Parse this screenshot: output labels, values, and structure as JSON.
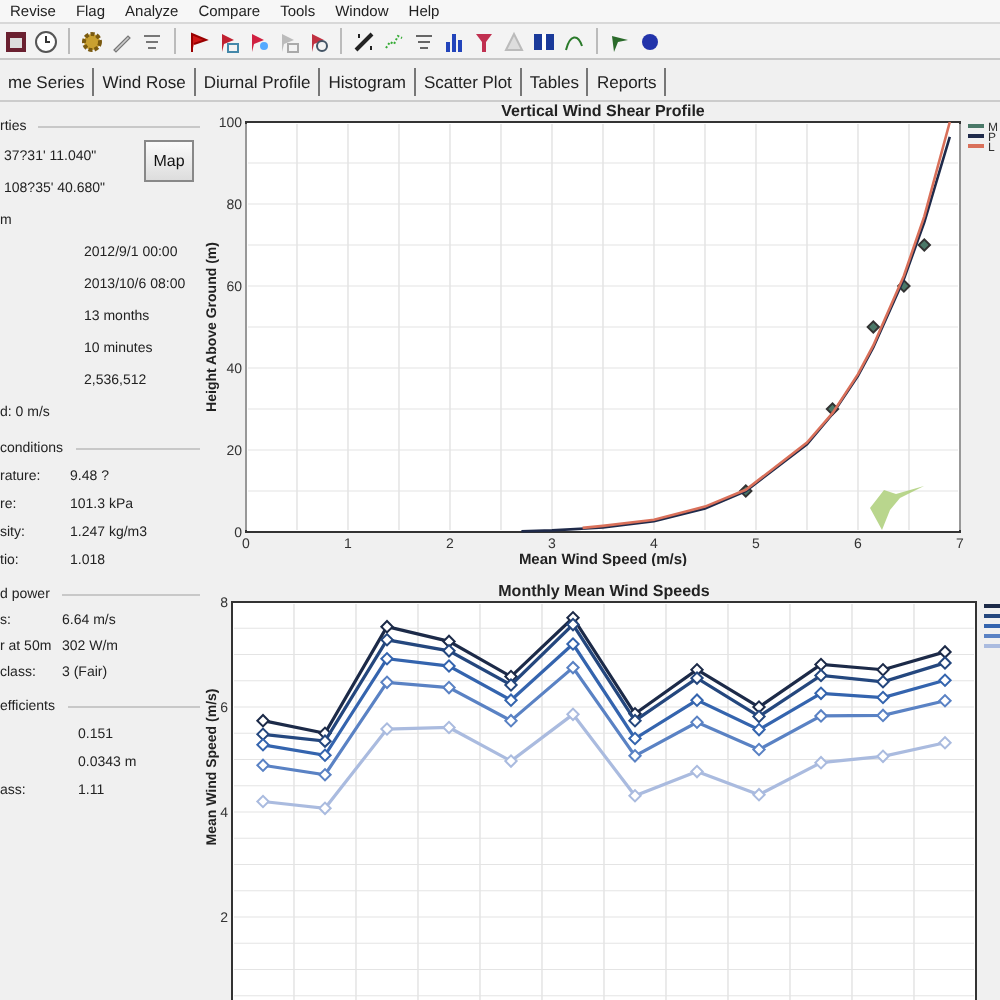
{
  "menu": [
    "Revise",
    "Flag",
    "Analyze",
    "Compare",
    "Tools",
    "Window",
    "Help"
  ],
  "tabs": [
    {
      "label": "me Series",
      "selected": false
    },
    {
      "label": "Wind Rose",
      "selected": false
    },
    {
      "label": "Diurnal Profile",
      "selected": false
    },
    {
      "label": "Histogram",
      "selected": false
    },
    {
      "label": "Scatter Plot",
      "selected": false
    },
    {
      "label": "Tables",
      "selected": false
    },
    {
      "label": "Reports",
      "selected": false
    }
  ],
  "properties": {
    "map_button": "Map",
    "groups": [
      {
        "title": "rties",
        "rows": [
          {
            "value": "37?31' 11.040\""
          },
          {
            "value": "108?35' 40.680\""
          },
          {
            "label": "m"
          },
          {
            "value": "2012/9/1 00:00"
          },
          {
            "value": "2013/10/6 08:00"
          },
          {
            "value": "13 months"
          },
          {
            "value": "10 minutes"
          },
          {
            "value": "2,536,512"
          },
          {
            "label": "d: 0 m/s"
          }
        ]
      },
      {
        "title": "conditions",
        "rows": [
          {
            "label": "rature:",
            "value": "9.48 ?"
          },
          {
            "label": "re:",
            "value": "101.3 kPa"
          },
          {
            "label": "sity:",
            "value": "1.247 kg/m3"
          },
          {
            "label": "tio:",
            "value": "1.018"
          }
        ]
      },
      {
        "title": "d power",
        "rows": [
          {
            "label": "s:",
            "value": "6.64 m/s"
          },
          {
            "label": "r at 50m",
            "value": "302 W/m"
          },
          {
            "label": "class:",
            "value": "3  (Fair)"
          }
        ]
      },
      {
        "title": "efficients",
        "rows": [
          {
            "value": "0.151"
          },
          {
            "value": "0.0343 m"
          },
          {
            "label": "ass:",
            "value": "1.11"
          }
        ]
      }
    ]
  },
  "shear_chart": {
    "chart_data": {
      "type": "line",
      "title": "Vertical Wind Shear Profile",
      "xlabel": "Mean Wind Speed (m/s)",
      "ylabel": "Height Above Ground (m)",
      "x": [
        2.7,
        3,
        3.3,
        3.5,
        4,
        4.5,
        4.9,
        5.5,
        5.75,
        6,
        6.15,
        6.45,
        6.65,
        6.9
      ],
      "series": [
        {
          "name": "M",
          "type": "scatter",
          "marker": "diamond",
          "color": "#4a7868",
          "values": [
            null,
            null,
            null,
            null,
            null,
            null,
            10,
            null,
            30,
            null,
            50,
            60,
            70,
            null
          ]
        },
        {
          "name": "P",
          "color": "#1f2a4a",
          "values": [
            0.2,
            0.4,
            null,
            1.1,
            2.6,
            5.7,
            10,
            21.4,
            28.8,
            38.1,
            45,
            61.7,
            75.5,
            96.4
          ]
        },
        {
          "name": "L",
          "color": "#d9705a",
          "values": [
            null,
            null,
            1,
            1.5,
            3,
            6.2,
            10.3,
            21.8,
            29,
            38.5,
            45.5,
            62.5,
            77,
            100
          ]
        }
      ],
      "xlim": [
        0,
        7
      ],
      "ylim": [
        0,
        100
      ],
      "xticks": [
        0,
        1,
        2,
        3,
        4,
        5,
        6,
        7
      ],
      "yticks": [
        0,
        20,
        40,
        60,
        80,
        100
      ],
      "grid": true,
      "legend": "right"
    }
  },
  "monthly_chart": {
    "chart_data": {
      "type": "line",
      "title": "Monthly Mean Wind Speeds",
      "ylabel": "Mean Wind Speed (m/s)",
      "series": [
        {
          "color": "#1c2a48",
          "marker": "diamond",
          "values": [
            5.74,
            5.5,
            7.53,
            7.25,
            6.58,
            7.7,
            5.87,
            6.71,
            6.0,
            6.81,
            6.71,
            7.05
          ]
        },
        {
          "color": "#24477e",
          "marker": "diamond",
          "values": [
            5.48,
            5.35,
            7.28,
            7.07,
            6.42,
            7.57,
            5.74,
            6.55,
            5.82,
            6.6,
            6.48,
            6.84
          ]
        },
        {
          "color": "#3464ae",
          "marker": "diamond",
          "values": [
            5.28,
            5.08,
            6.92,
            6.78,
            6.13,
            7.2,
            5.4,
            6.13,
            5.57,
            6.26,
            6.18,
            6.51
          ]
        },
        {
          "color": "#5a82c4",
          "marker": "diamond",
          "values": [
            4.89,
            4.71,
            6.47,
            6.37,
            5.74,
            6.75,
            5.07,
            5.71,
            5.19,
            5.83,
            5.84,
            6.12
          ]
        },
        {
          "color": "#aabbdf",
          "marker": "diamond",
          "values": [
            4.2,
            4.07,
            5.58,
            5.61,
            4.97,
            5.86,
            4.31,
            4.77,
            4.33,
            4.94,
            5.06,
            5.32
          ]
        }
      ],
      "ylim": [
        0,
        8
      ],
      "yticks": [
        2,
        4,
        6,
        8
      ],
      "grid": true,
      "legend": "right"
    }
  }
}
